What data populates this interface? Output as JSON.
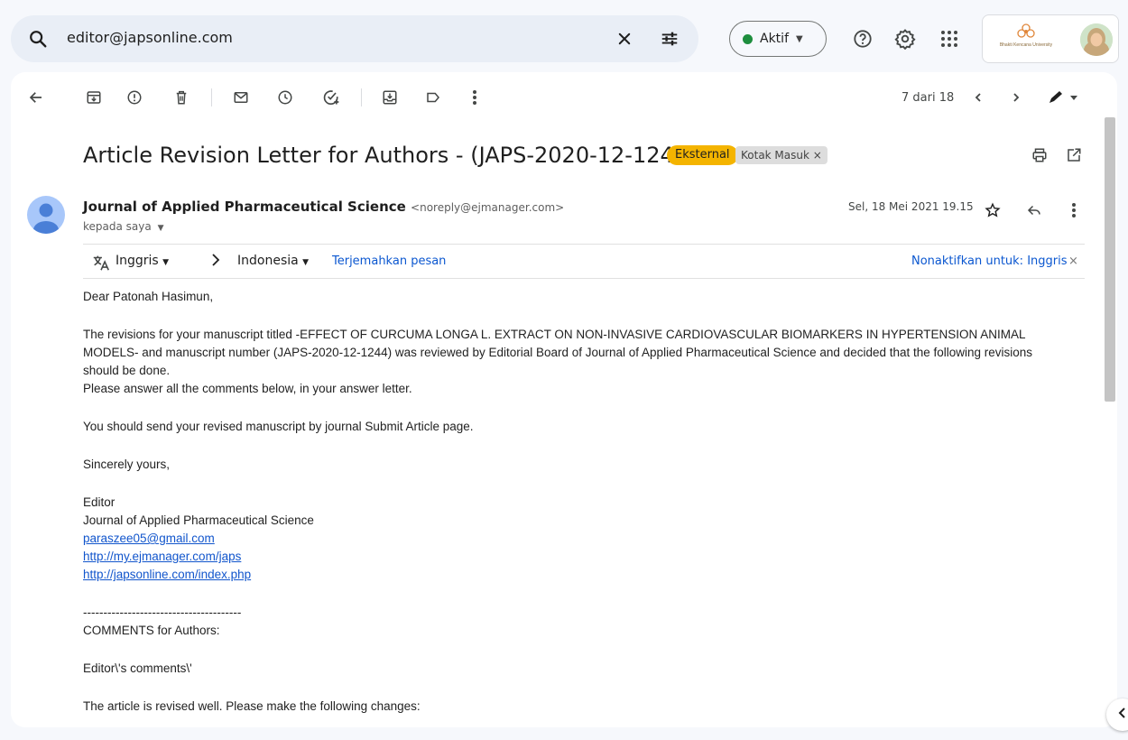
{
  "search": {
    "query": "editor@japsonline.com"
  },
  "status": {
    "label": "Aktif"
  },
  "account": {
    "org_name": "Bhakti Kencana University"
  },
  "toolbar": {
    "page_count": "7 dari 18"
  },
  "message": {
    "subject": "Article Revision Letter for Authors - (JAPS-2020-12-1244)",
    "label_external": "Eksternal",
    "label_inbox": "Kotak Masuk",
    "label_close": "×",
    "sender_name": "Journal of Applied Pharmaceutical Science",
    "sender_email": "<noreply@ejmanager.com>",
    "to": "kepada saya",
    "date": "Sel, 18 Mei 2021 19.15"
  },
  "translate": {
    "from": "Inggris",
    "to": "Indonesia",
    "action": "Terjemahkan pesan",
    "disable": "Nonaktifkan untuk: Inggris"
  },
  "body": {
    "greeting": "Dear Patonah Hasimun,",
    "p1": "The revisions for your manuscript titled -EFFECT OF CURCUMA LONGA L. EXTRACT ON NON-INVASIVE CARDIOVASCULAR BIOMARKERS IN HYPERTENSION ANIMAL MODELS- and manuscript number (JAPS-2020-12-1244) was reviewed by Editorial Board of Journal of Applied Pharmaceutical Science and decided that the following revisions should be done.",
    "p2": "Please answer all the comments below, in your answer letter.",
    "p3": "You should send your revised manuscript by journal Submit Article page.",
    "closing": "Sincerely yours,",
    "sig_role": "Editor",
    "sig_journal": "Journal of Applied Pharmaceutical Science",
    "link1": "paraszee05@gmail.com",
    "link2": "http://my.ejmanager.com/japs",
    "link3": "http://japsonline.com/index.php",
    "divider": "---------------------------------------",
    "comments_heading": "COMMENTS for Authors:",
    "editor_comments": "Editor\\'s comments\\'",
    "cut_line": "The article is revised well. Please make the following changes:"
  }
}
